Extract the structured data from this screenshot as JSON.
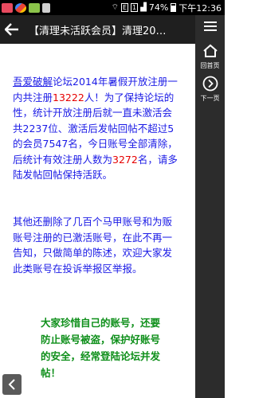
{
  "statusbar": {
    "battery": "74%",
    "time": "下午12:36",
    "box_label": "E",
    "sim_label": "1"
  },
  "titlebar": {
    "title": "【清理未活跃会员】清理20…"
  },
  "sidepanel": {
    "home_label": "回首页",
    "next_label": "下一页"
  },
  "post": {
    "p1": {
      "l1_a": "吾爱破解",
      "l1_b": "论坛2014年暑假开放注册一",
      "l2_a": "内共注册",
      "l2_b": "13222",
      "l2_c": "人！为了保持论坛的",
      "l3": "性，统计开放注册后就一直未激活会",
      "l4": "共2237位、激活后发帖回帖不超过5",
      "l5": "的会员7547名，今日账号全部清除，",
      "l6_a": "后统计有效注册人数为",
      "l6_b": "3272",
      "l6_c": "名，请多",
      "l7": "陆发帖回帖保持活跃。"
    },
    "p2": {
      "l1": "其他还删除了几百个马甲账号和为贩",
      "l2": "账号注册的已激活账号，在此不再一",
      "l3": "告知，只做简单的陈述，欢迎大家发",
      "l4": "此类账号在投诉举报区举报。"
    },
    "p3": {
      "l1": "大家珍惜自己的账号，还要",
      "l2": "防止账号被盗，保护好账号",
      "l3": "的安全，经常登陆论坛并发",
      "l4": "帖！"
    }
  },
  "colors": {
    "body_text": "#1a1ae6",
    "highlight": "#e60000",
    "notice": "#0e8f1a"
  }
}
